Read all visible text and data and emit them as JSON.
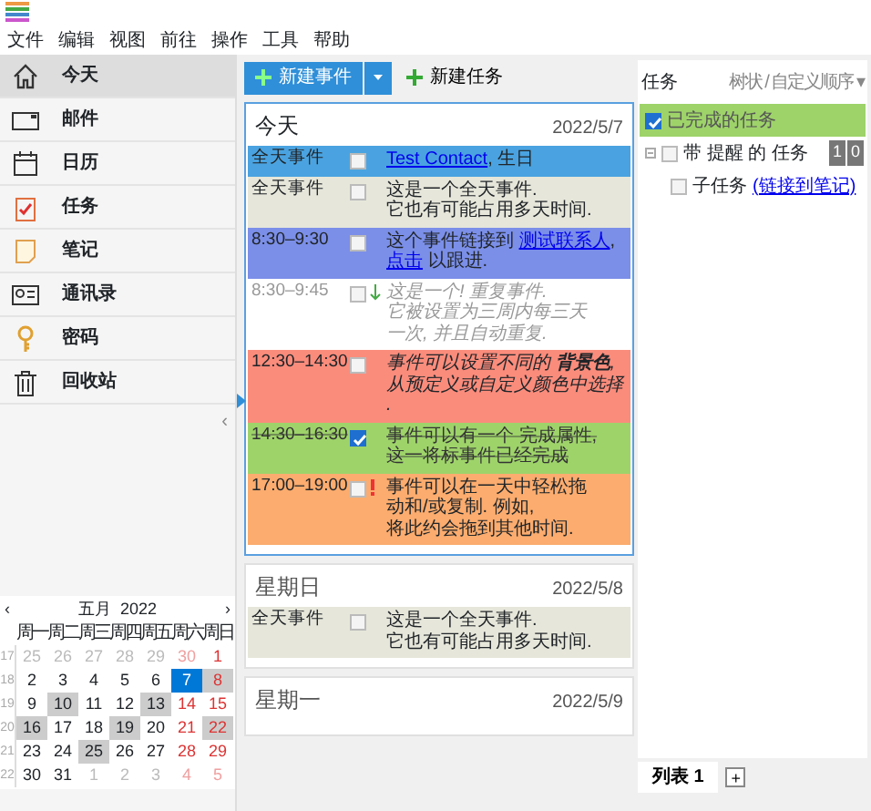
{
  "menu": [
    "文件",
    "编辑",
    "视图",
    "前往",
    "操作",
    "工具",
    "帮助"
  ],
  "sidebar": {
    "items": [
      {
        "label": "今天",
        "selected": true
      },
      {
        "label": "邮件",
        "selected": false
      },
      {
        "label": "日历",
        "selected": false
      },
      {
        "label": "任务",
        "selected": false
      },
      {
        "label": "笔记",
        "selected": false
      },
      {
        "label": "通讯录",
        "selected": false
      },
      {
        "label": "密码",
        "selected": false
      },
      {
        "label": "回收站",
        "selected": false
      }
    ],
    "collapse": "‹"
  },
  "mini_calendar": {
    "prev": "‹",
    "next": "›",
    "month": "五月",
    "year": "2022",
    "weekdays": [
      "周一",
      "周二",
      "周三",
      "周四",
      "周五",
      "周六",
      "周日"
    ],
    "weeks": [
      {
        "number": "17",
        "days": [
          {
            "day": "25",
            "other_month": true,
            "weekend": false,
            "selected": false,
            "has_events": false
          },
          {
            "day": "26",
            "other_month": true,
            "weekend": false,
            "selected": false,
            "has_events": false
          },
          {
            "day": "27",
            "other_month": true,
            "weekend": false,
            "selected": false,
            "has_events": false
          },
          {
            "day": "28",
            "other_month": true,
            "weekend": false,
            "selected": false,
            "has_events": false
          },
          {
            "day": "29",
            "other_month": true,
            "weekend": false,
            "selected": false,
            "has_events": false
          },
          {
            "day": "30",
            "other_month": true,
            "weekend": true,
            "selected": false,
            "has_events": false
          },
          {
            "day": "1",
            "other_month": false,
            "weekend": true,
            "selected": false,
            "has_events": false
          }
        ]
      },
      {
        "number": "18",
        "days": [
          {
            "day": "2",
            "other_month": false,
            "weekend": false,
            "selected": false,
            "has_events": false
          },
          {
            "day": "3",
            "other_month": false,
            "weekend": false,
            "selected": false,
            "has_events": false
          },
          {
            "day": "4",
            "other_month": false,
            "weekend": false,
            "selected": false,
            "has_events": false
          },
          {
            "day": "5",
            "other_month": false,
            "weekend": false,
            "selected": false,
            "has_events": false
          },
          {
            "day": "6",
            "other_month": false,
            "weekend": false,
            "selected": false,
            "has_events": false
          },
          {
            "day": "7",
            "other_month": false,
            "weekend": true,
            "selected": true,
            "has_events": true
          },
          {
            "day": "8",
            "other_month": false,
            "weekend": true,
            "selected": false,
            "has_events": true
          }
        ]
      },
      {
        "number": "19",
        "days": [
          {
            "day": "9",
            "other_month": false,
            "weekend": false,
            "selected": false,
            "has_events": false
          },
          {
            "day": "10",
            "other_month": false,
            "weekend": false,
            "selected": false,
            "has_events": true
          },
          {
            "day": "11",
            "other_month": false,
            "weekend": false,
            "selected": false,
            "has_events": false
          },
          {
            "day": "12",
            "other_month": false,
            "weekend": false,
            "selected": false,
            "has_events": false
          },
          {
            "day": "13",
            "other_month": false,
            "weekend": false,
            "selected": false,
            "has_events": true
          },
          {
            "day": "14",
            "other_month": false,
            "weekend": true,
            "selected": false,
            "has_events": false
          },
          {
            "day": "15",
            "other_month": false,
            "weekend": true,
            "selected": false,
            "has_events": false
          }
        ]
      },
      {
        "number": "20",
        "days": [
          {
            "day": "16",
            "other_month": false,
            "weekend": false,
            "selected": false,
            "has_events": true
          },
          {
            "day": "17",
            "other_month": false,
            "weekend": false,
            "selected": false,
            "has_events": false
          },
          {
            "day": "18",
            "other_month": false,
            "weekend": false,
            "selected": false,
            "has_events": false
          },
          {
            "day": "19",
            "other_month": false,
            "weekend": false,
            "selected": false,
            "has_events": true
          },
          {
            "day": "20",
            "other_month": false,
            "weekend": false,
            "selected": false,
            "has_events": false
          },
          {
            "day": "21",
            "other_month": false,
            "weekend": true,
            "selected": false,
            "has_events": false
          },
          {
            "day": "22",
            "other_month": false,
            "weekend": true,
            "selected": false,
            "has_events": true
          }
        ]
      },
      {
        "number": "21",
        "days": [
          {
            "day": "23",
            "other_month": false,
            "weekend": false,
            "selected": false,
            "has_events": false
          },
          {
            "day": "24",
            "other_month": false,
            "weekend": false,
            "selected": false,
            "has_events": false
          },
          {
            "day": "25",
            "other_month": false,
            "weekend": false,
            "selected": false,
            "has_events": true
          },
          {
            "day": "26",
            "other_month": false,
            "weekend": false,
            "selected": false,
            "has_events": false
          },
          {
            "day": "27",
            "other_month": false,
            "weekend": false,
            "selected": false,
            "has_events": false
          },
          {
            "day": "28",
            "other_month": false,
            "weekend": true,
            "selected": false,
            "has_events": false
          },
          {
            "day": "29",
            "other_month": false,
            "weekend": true,
            "selected": false,
            "has_events": false
          }
        ]
      },
      {
        "number": "22",
        "days": [
          {
            "day": "30",
            "other_month": false,
            "weekend": false,
            "selected": false,
            "has_events": false
          },
          {
            "day": "31",
            "other_month": false,
            "weekend": false,
            "selected": false,
            "has_events": false
          },
          {
            "day": "1",
            "other_month": true,
            "weekend": false,
            "selected": false,
            "has_events": false
          },
          {
            "day": "2",
            "other_month": true,
            "weekend": false,
            "selected": false,
            "has_events": false
          },
          {
            "day": "3",
            "other_month": true,
            "weekend": false,
            "selected": false,
            "has_events": false
          },
          {
            "day": "4",
            "other_month": true,
            "weekend": true,
            "selected": false,
            "has_events": false
          },
          {
            "day": "5",
            "other_month": true,
            "weekend": true,
            "selected": false,
            "has_events": false
          }
        ]
      }
    ]
  },
  "toolbar": {
    "new_event": "新建事件",
    "new_task": "新建任务"
  },
  "days": [
    {
      "title": "今天",
      "date": "2022/5/7",
      "selected": true,
      "events": [
        {
          "kind": "plain",
          "time": "全天事件",
          "color": "#4aa3e0",
          "checked": false,
          "lines": [
            [
              {
                "t": "Test Contact",
                "link": true
              },
              {
                "t": ", 生日",
                "link": false
              }
            ]
          ]
        },
        {
          "kind": "plain",
          "time": "全天事件",
          "color": "#e6e6da",
          "checked": false,
          "lines": [
            [
              {
                "t": "这是一个全天事件.",
                "link": false
              }
            ],
            [
              {
                "t": "它也有可能占用多天时间.",
                "link": false
              }
            ]
          ]
        },
        {
          "kind": "plain",
          "time": "8:30–9:30",
          "color": "#7b8fe8",
          "checked": false,
          "lines": [
            [
              {
                "t": "这个事件链接到 ",
                "link": false
              },
              {
                "t": "测试联系人",
                "link": true
              },
              {
                "t": ",",
                "link": false
              }
            ],
            [
              {
                "t": "点击",
                "link": true
              },
              {
                "t": " 以跟进.",
                "link": false
              }
            ]
          ]
        },
        {
          "kind": "recurring",
          "time": "8:30–9:45",
          "color": "#ffffff",
          "checked": false,
          "lines": [
            [
              {
                "t": "这是一个! 重复事件.",
                "link": false
              }
            ],
            [
              {
                "t": "它被设置为三周内每三天",
                "link": false
              }
            ],
            [
              {
                "t": "一次, 并且自动重复.",
                "link": false
              }
            ]
          ]
        },
        {
          "kind": "italic",
          "time": "12:30–14:30",
          "color": "#fa8c7c",
          "checked": false,
          "lines": [
            [
              {
                "t": "事件可以设置不同的 **背景色**,",
                "link": false
              }
            ],
            [
              {
                "t": "从预定义或自定义颜色中选择",
                "link": false
              }
            ],
            [
              {
                "t": ".",
                "link": false
              }
            ]
          ]
        },
        {
          "kind": "done",
          "time": "14:30–16:30",
          "color": "#9ed36a",
          "checked": true,
          "lines": [
            [
              {
                "t": "事件可以有一个 完成属性,",
                "link": false
              }
            ],
            [
              {
                "t": "这一将标事件已经完成",
                "link": false
              }
            ]
          ]
        },
        {
          "kind": "priority",
          "time": "17:00–19:00",
          "color": "#fbac6e",
          "checked": false,
          "lines": [
            [
              {
                "t": "事件可以在一天中轻松拖",
                "link": false
              }
            ],
            [
              {
                "t": "动和/或复制. 例如,",
                "link": false
              }
            ],
            [
              {
                "t": "将此约会拖到其他时间.",
                "link": false
              }
            ]
          ]
        }
      ]
    },
    {
      "title": "星期日",
      "date": "2022/5/8",
      "selected": false,
      "events": [
        {
          "kind": "plain",
          "time": "全天事件",
          "color": "#e6e6da",
          "checked": false,
          "lines": [
            [
              {
                "t": "这是一个全天事件.",
                "link": false
              }
            ],
            [
              {
                "t": "它也有可能占用多天时间.",
                "link": false
              }
            ]
          ]
        }
      ]
    },
    {
      "title": "星期一",
      "date": "2022/5/9",
      "selected": false
    }
  ],
  "tasks": {
    "title": "任务",
    "sort": "树状 / 自定义顺序 ▾",
    "items": [
      {
        "label": "已完成的任务",
        "checked": true
      },
      {
        "label": "带 提醒 的 任务",
        "checked": false,
        "badges": [
          "1",
          "0"
        ],
        "children": [
          {
            "label": "子任务",
            "link": "(链接到笔记)",
            "checked": false
          }
        ]
      }
    ]
  },
  "bottom_tabs": [
    {
      "label": "列表 1",
      "selected": true
    }
  ],
  "add_tab": "+"
}
